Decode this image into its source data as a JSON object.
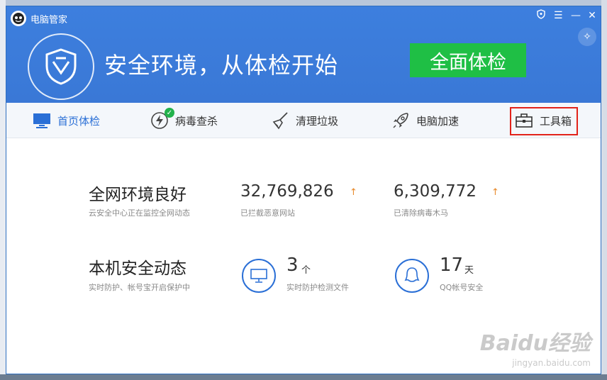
{
  "app": {
    "title": "电脑管家",
    "logo_text": ""
  },
  "header": {
    "headline": "安全环境，从体检开始",
    "scan_button": "全面体检",
    "accent_color": "#3d7fde",
    "button_color": "#1fbf45"
  },
  "window_controls": {
    "icons": [
      "shield-icon",
      "menu-icon",
      "minimize-icon",
      "close-icon"
    ],
    "menu": "☰",
    "minimize": "—",
    "close": "✕",
    "sparkle": "✧"
  },
  "nav": {
    "home": "首页体检",
    "virus": "病毒查杀",
    "clean": "清理垃圾",
    "speed": "电脑加速",
    "toolbox": "工具箱"
  },
  "stats": {
    "env_title": "全网环境良好",
    "env_sub": "云安全中心正在监控全网动态",
    "blocked_count": "32,769,826",
    "blocked_label": "已拦截恶意网站",
    "cleared_count": "6,309,772",
    "cleared_label": "已清除病毒木马",
    "local_title": "本机安全动态",
    "local_sub": "实时防护、帐号宝开启保护中",
    "files_count": "3",
    "files_unit": "个",
    "files_label": "实时防护检测文件",
    "days_count": "17",
    "days_unit": "天",
    "days_label": "QQ帐号安全",
    "arrow": "↑"
  },
  "watermark": {
    "main": "Baidu经验",
    "sub": "jingyan.baidu.com"
  }
}
